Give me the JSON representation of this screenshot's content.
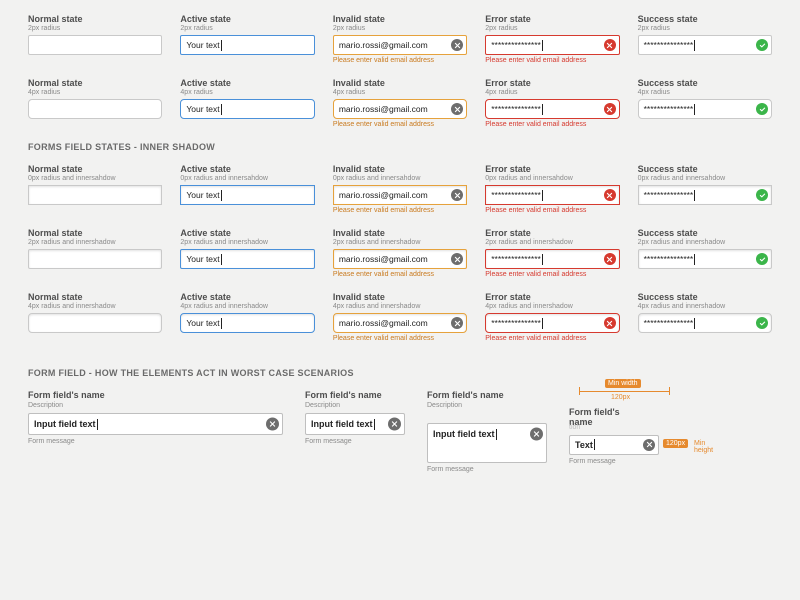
{
  "states": {
    "normal": {
      "title": "Normal state",
      "value": ""
    },
    "active": {
      "title": "Active state",
      "value": "Your text"
    },
    "invalid": {
      "title": "Invalid state",
      "value": "mario.rossi@gmail.com",
      "msg": "Please enter valid email address"
    },
    "error": {
      "title": "Error state",
      "value": "***************",
      "msg": "Please enter valid email address"
    },
    "success": {
      "title": "Success state",
      "value": "***************"
    }
  },
  "subs": {
    "r2": "2px radius",
    "r4": "4px radius",
    "r0i": "0px radius and innersahdow",
    "r2i": "2px radius and innershadow",
    "r4i": "4px radius and innershadow"
  },
  "section_inner": "FORMS FIELD STATES - INNER SHADOW",
  "section_worst": "FORM FIELD - HOW THE ELEMENTS ACT IN WORST CASE SCENARIOS",
  "wc": {
    "title": "Form field's name",
    "desc": "Description",
    "value": "Input field text",
    "msg": "Form message",
    "short_title": "Form field's name",
    "short_value": "Text",
    "dims": {
      "min_width_label": "Min width",
      "min_width_val": "120px",
      "min_height_val": "120px",
      "min_height_label": "Min height"
    }
  }
}
